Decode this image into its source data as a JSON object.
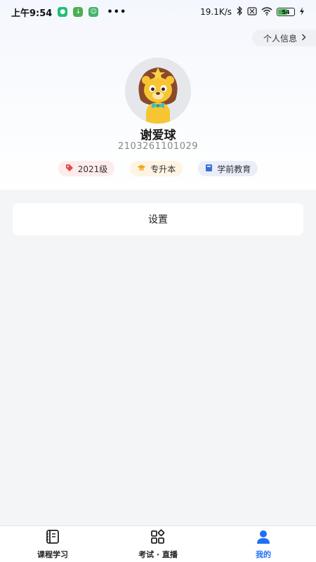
{
  "status_bar": {
    "time": "上午9:54",
    "dots": "•••",
    "network_speed": "19.1K/s",
    "battery_level": "54"
  },
  "profile": {
    "info_link": "个人信息",
    "name": "谢爱球",
    "student_id": "2103261101029",
    "tags": {
      "grade": "2021级",
      "level": "专升本",
      "major": "学前教育"
    }
  },
  "menu": {
    "settings": "设置"
  },
  "tabbar": {
    "items": [
      {
        "label": "课程学习",
        "icon": "notebook-icon"
      },
      {
        "label": "考试 · 直播",
        "icon": "apps-icon"
      },
      {
        "label": "我的",
        "icon": "user-icon"
      }
    ],
    "active_index": 2
  },
  "colors": {
    "accent": "#1e6ff5",
    "tag_grade_icon": "#e5484d",
    "tag_level_icon": "#f5a623",
    "tag_major_icon": "#3b6fd8"
  }
}
